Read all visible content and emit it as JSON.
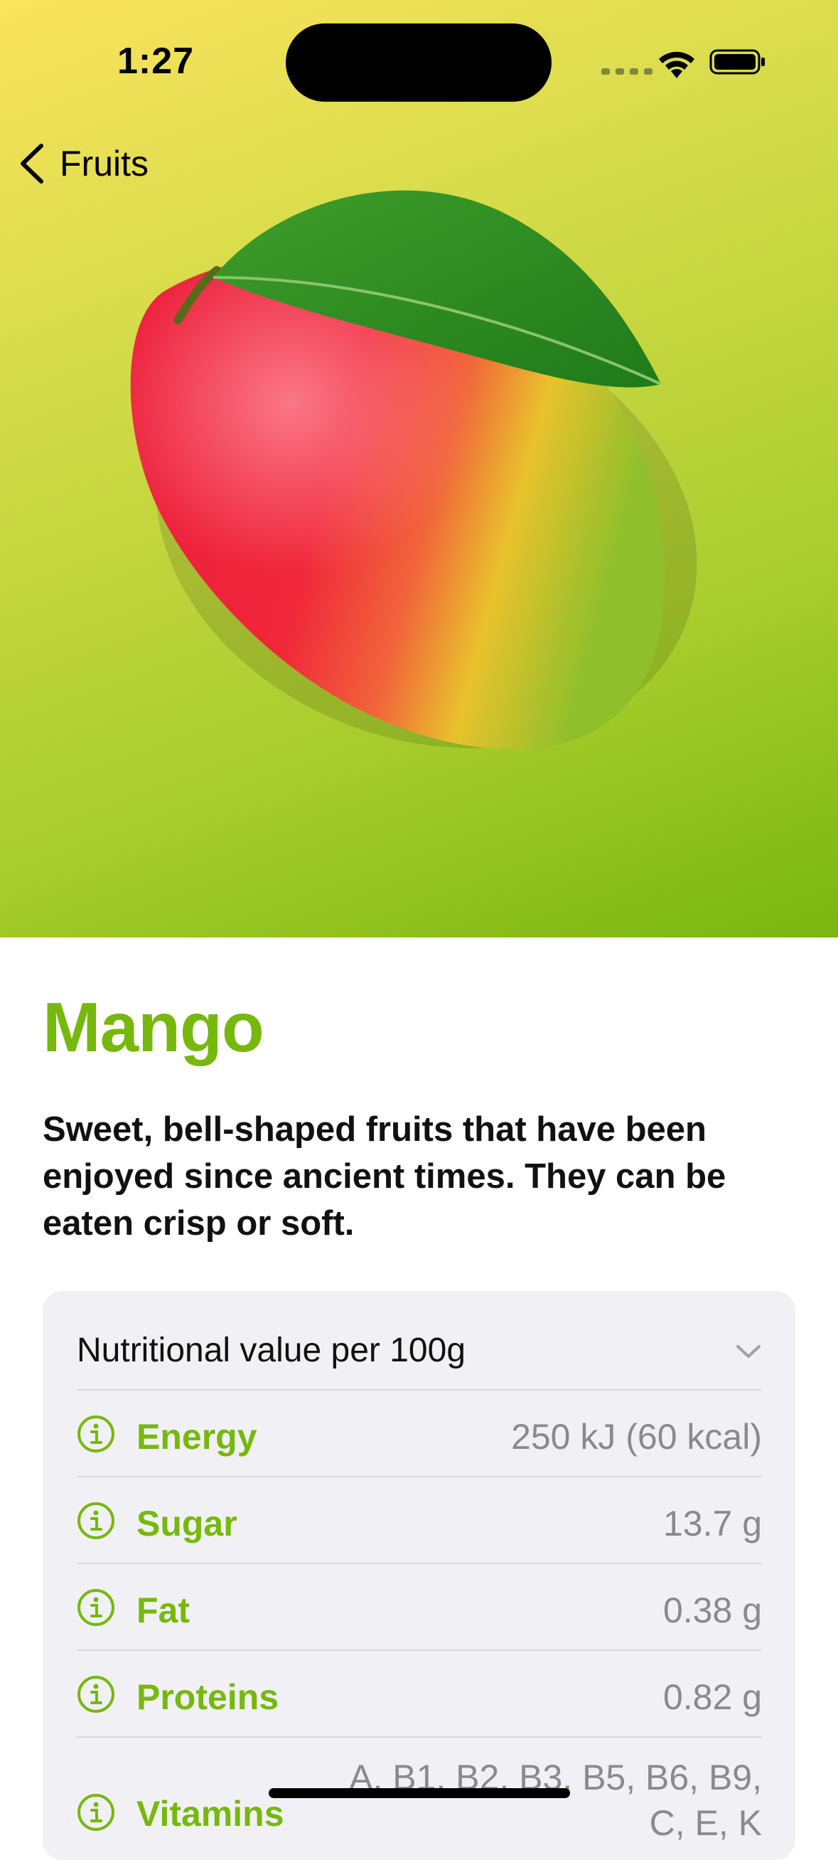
{
  "status": {
    "time": "1:27"
  },
  "nav": {
    "back_label": "Fruits"
  },
  "fruit": {
    "name": "Mango",
    "description": "Sweet, bell-shaped fruits that have been enjoyed since ancient times. They can be eaten crisp or soft.",
    "accent_color": "#76b80c"
  },
  "nutrition": {
    "title": "Nutritional value per 100g",
    "rows": [
      {
        "label": "Energy",
        "value": "250 kJ (60 kcal)"
      },
      {
        "label": "Sugar",
        "value": "13.7 g"
      },
      {
        "label": "Fat",
        "value": "0.38 g"
      },
      {
        "label": "Proteins",
        "value": "0.82 g"
      },
      {
        "label": "Vitamins",
        "value": "A, B1, B2, B3, B5, B6, B9, C, E, K"
      }
    ]
  },
  "icons": {
    "back": "chevron-left-icon",
    "info": "info-circle-icon",
    "expand": "chevron-down-icon"
  }
}
